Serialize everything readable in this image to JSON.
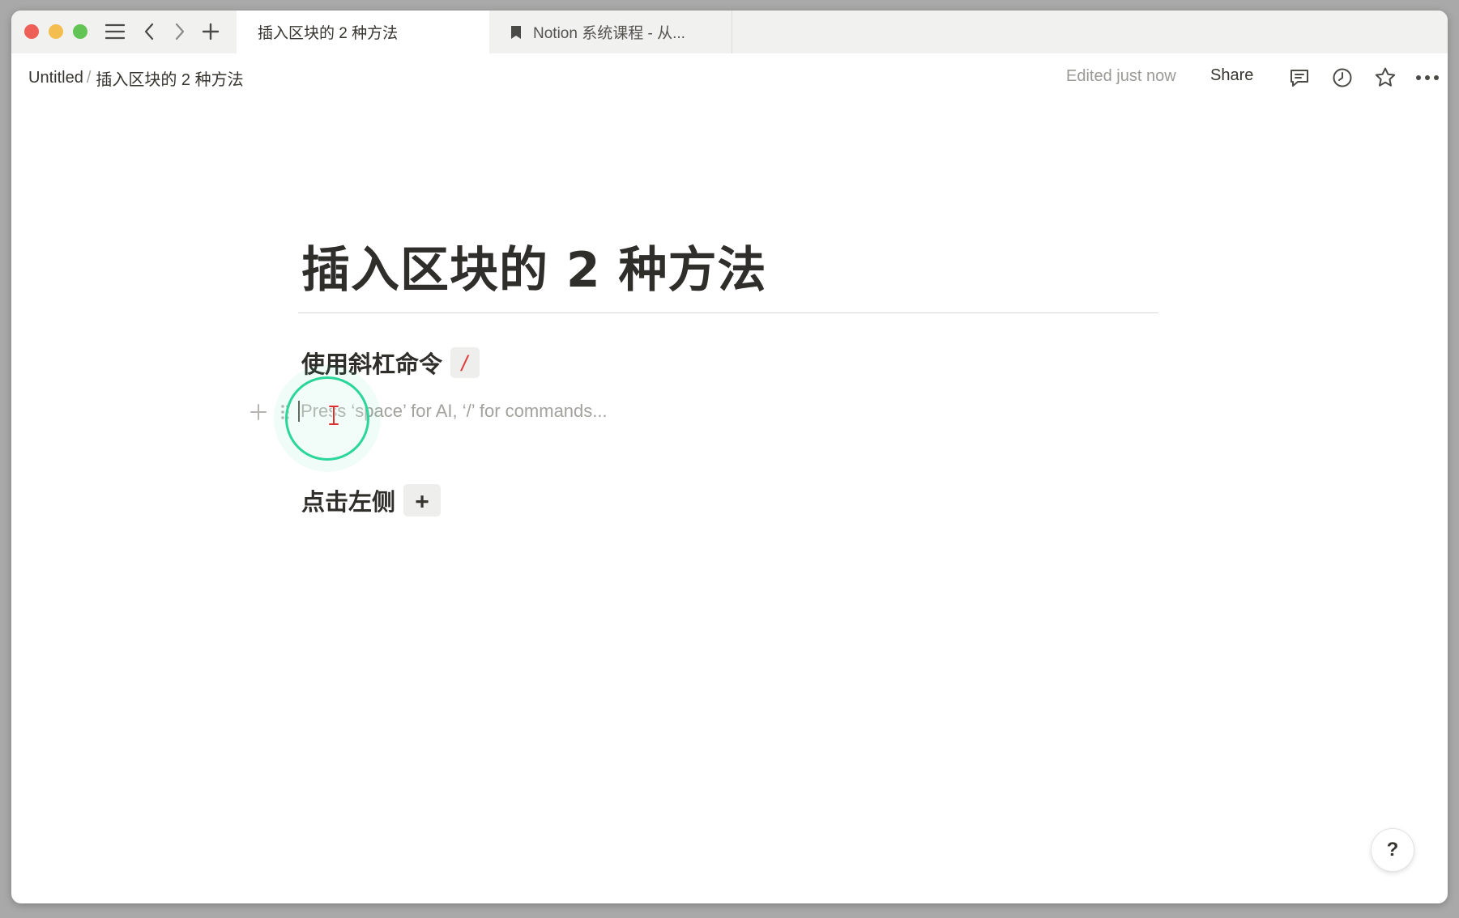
{
  "window": {
    "tabs": [
      {
        "label": "插入区块的 2 种方法",
        "active": true
      },
      {
        "label": "Notion 系统课程 - 从...",
        "active": false,
        "icon": "bookmark-icon"
      }
    ],
    "toolbar_icons": [
      "sidebar-toggle-icon",
      "back-arrow-icon",
      "forward-arrow-icon",
      "new-tab-plus-icon"
    ]
  },
  "topbar": {
    "breadcrumb": [
      "Untitled",
      "插入区块的 2 种方法"
    ],
    "breadcrumb_separator": "/",
    "edited": "Edited just now",
    "share": "Share",
    "icons": [
      "comment-icon",
      "history-clock-icon",
      "favorite-star-icon",
      "more-dots-icon"
    ]
  },
  "page": {
    "title": "插入区块的 2 种方法",
    "sections": [
      {
        "heading": "使用斜杠命令",
        "chip": "/"
      },
      {
        "heading": "点击左侧",
        "chip": "+"
      }
    ],
    "empty_block": {
      "placeholder": "Press ‘space’ for AI, ‘/’ for commands..."
    }
  },
  "help": {
    "label": "?"
  },
  "colors": {
    "accent_click_ring": "#2bd69a",
    "slash_chip_text": "#e03e3e",
    "text_primary": "#37352f",
    "text_muted": "#9b9a97"
  }
}
